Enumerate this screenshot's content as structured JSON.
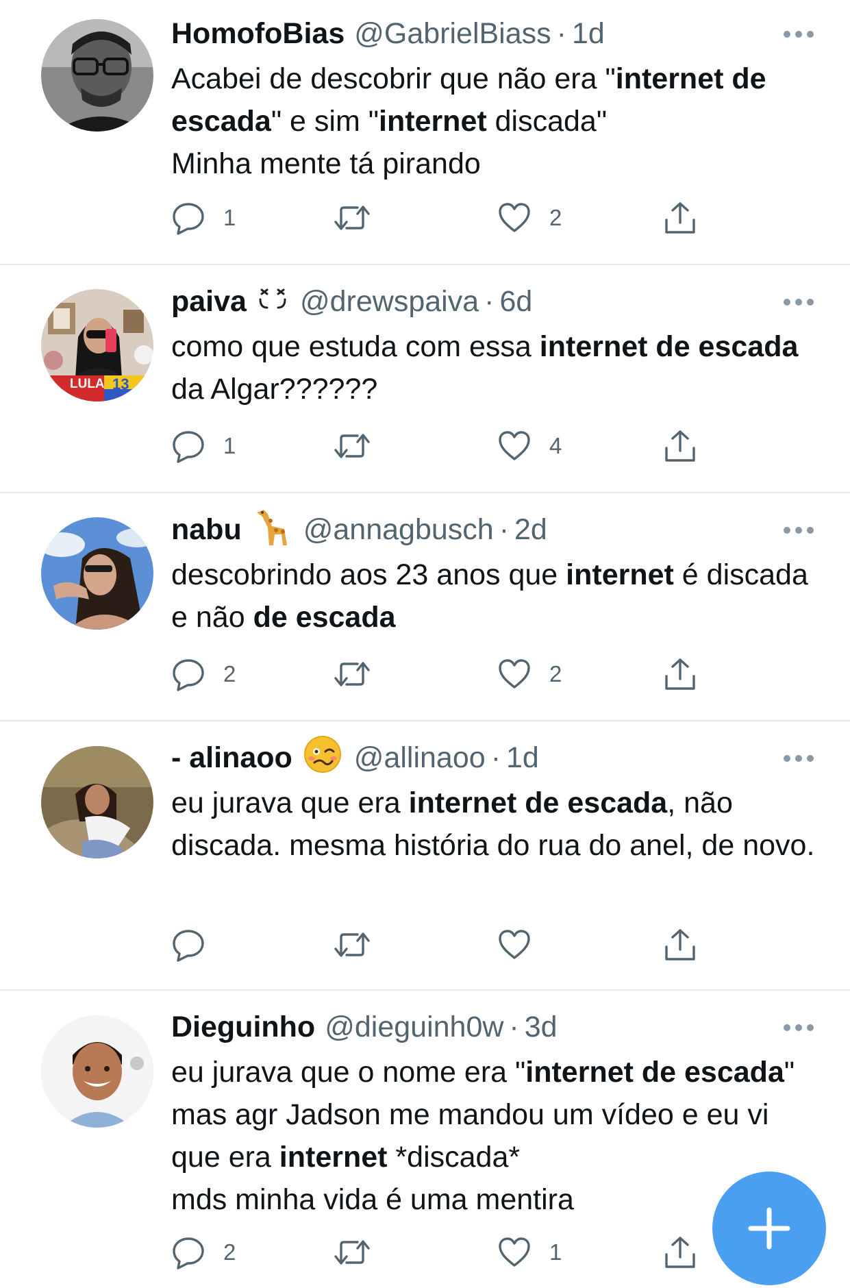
{
  "tweets": [
    {
      "name": "HomofoBias",
      "handle": "@GabrielBiass",
      "separator": "·",
      "time": "1d",
      "body_segments": [
        {
          "text": "Acabei de descobrir que não era \"",
          "bold": false
        },
        {
          "text": "internet de escada",
          "bold": true
        },
        {
          "text": "\" e sim \"",
          "bold": false
        },
        {
          "text": "internet",
          "bold": true
        },
        {
          "text": " discada\"\nMinha mente tá pirando",
          "bold": false
        }
      ],
      "replies": "1",
      "retweets": "",
      "likes": "2"
    },
    {
      "name": "paiva",
      "emoji_icon": "smiling-face-with-closed-eyes-icon",
      "handle": "@drewspaiva",
      "separator": "·",
      "time": "6d",
      "avatar_badge": {
        "text": "LULA",
        "number": "13"
      },
      "body_segments": [
        {
          "text": "como que estuda com essa ",
          "bold": false
        },
        {
          "text": "internet de escada",
          "bold": true
        },
        {
          "text": " da Algar??????",
          "bold": false
        }
      ],
      "replies": "1",
      "retweets": "",
      "likes": "4"
    },
    {
      "name": "nabu",
      "emoji_icon": "giraffe-icon",
      "handle": "@annagbusch",
      "separator": "·",
      "time": "2d",
      "body_segments": [
        {
          "text": "descobrindo aos 23 anos que ",
          "bold": false
        },
        {
          "text": "internet",
          "bold": true
        },
        {
          "text": " é discada e não ",
          "bold": false
        },
        {
          "text": "de escada",
          "bold": true
        }
      ],
      "replies": "2",
      "retweets": "",
      "likes": "2"
    },
    {
      "name": "- alinaoo",
      "emoji_icon": "woozy-face-icon",
      "handle": "@allinaoo",
      "separator": "·",
      "time": "1d",
      "body_segments": [
        {
          "text": "eu jurava que era ",
          "bold": false
        },
        {
          "text": "internet de escada",
          "bold": true
        },
        {
          "text": ", não discada. mesma história do rua do anel, de novo.",
          "bold": false
        }
      ],
      "replies": "",
      "retweets": "",
      "likes": ""
    },
    {
      "name": "Dieguinho",
      "handle": "@dieguinh0w",
      "separator": "·",
      "time": "3d",
      "body_segments": [
        {
          "text": "eu jurava que o nome era \"",
          "bold": false
        },
        {
          "text": "internet de escada",
          "bold": true
        },
        {
          "text": "\" mas agr Jadson me mandou um vídeo e eu vi que era ",
          "bold": false
        },
        {
          "text": "internet",
          "bold": true
        },
        {
          "text": " *discada*\nmds minha vida é uma mentira",
          "bold": false
        }
      ],
      "replies": "2",
      "retweets": "",
      "likes": "1"
    }
  ],
  "fab": {
    "icon": "plus-icon"
  },
  "colors": {
    "text": "#0f1419",
    "secondary": "#536471",
    "divider": "#e6e9ec",
    "fab": "#4a9ff0"
  }
}
